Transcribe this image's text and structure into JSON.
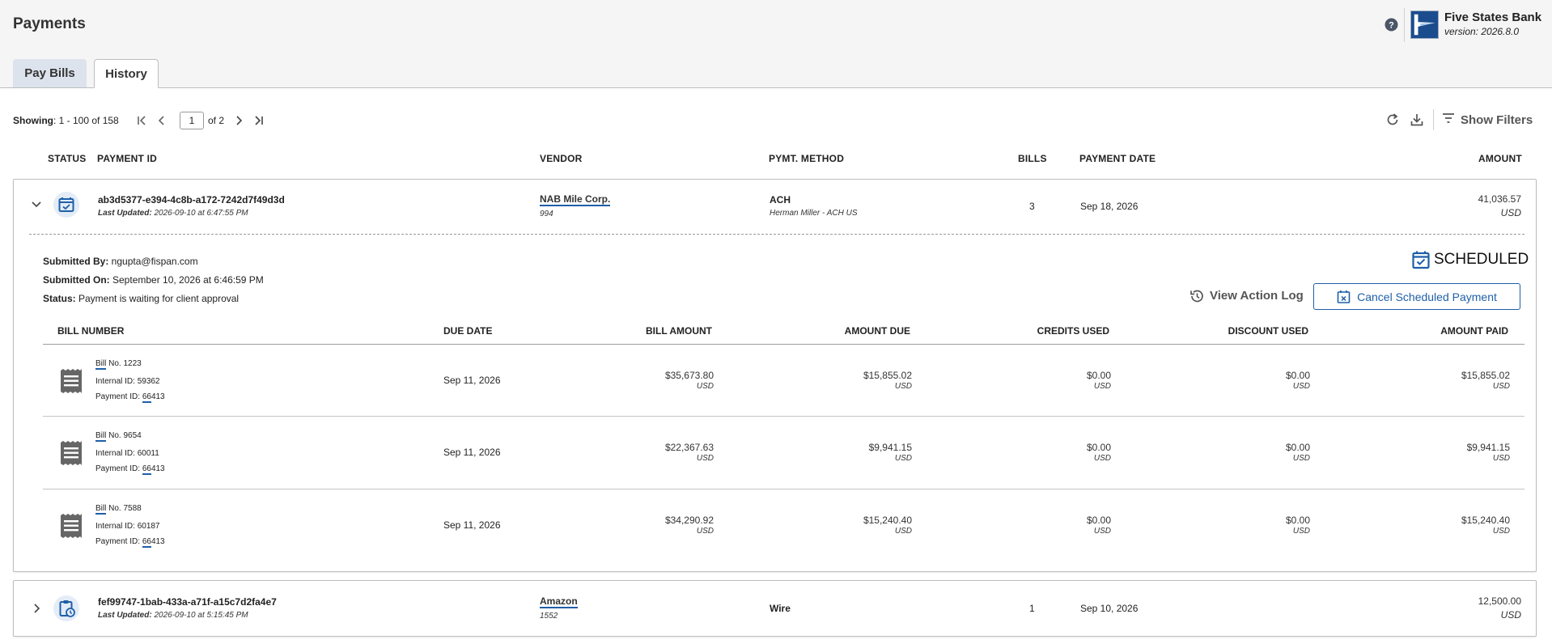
{
  "header": {
    "title": "Payments",
    "bank_name": "Five States Bank",
    "version": "version: 2026.8.0"
  },
  "tabs": [
    {
      "label": "Pay Bills",
      "active": false
    },
    {
      "label": "History",
      "active": true
    }
  ],
  "pager": {
    "showing_label": "Showing",
    "showing_range": ": 1 - 100 of 158",
    "current_page": "1",
    "of_pages": "of 2"
  },
  "toolbar": {
    "show_filters": "Show Filters"
  },
  "columns": {
    "status": "STATUS",
    "payment_id": "PAYMENT ID",
    "vendor": "VENDOR",
    "method": "PYMT. METHOD",
    "bills": "BILLS",
    "payment_date": "PAYMENT DATE",
    "amount": "AMOUNT"
  },
  "payments": [
    {
      "id": "ab3d5377-e394-4c8b-a172-7242d7f49d3d",
      "updated_label": "Last Updated:",
      "updated_value": " 2026-09-10 at 6:47:55 PM",
      "vendor": "NAB Mile Corp.",
      "vendor_id": "994",
      "method": "ACH",
      "method_sub": "Herman Miller - ACH US",
      "bills": "3",
      "payment_date": "Sep 18, 2026",
      "amount": "41,036.57",
      "currency": "USD",
      "expanded": true,
      "details": {
        "submitted_by_label": "Submitted By:",
        "submitted_by": " ngupta@fispan.com",
        "submitted_on_label": "Submitted On:",
        "submitted_on": " September 10, 2026 at 6:46:59 PM",
        "status_label": "Status:",
        "status": " Payment is waiting for client approval",
        "badge": "SCHEDULED",
        "view_action_log": "View Action Log",
        "cancel_button": "Cancel Scheduled Payment"
      },
      "bill_columns": {
        "bill_number": "BILL NUMBER",
        "due_date": "DUE DATE",
        "bill_amount": "BILL AMOUNT",
        "amount_due": "AMOUNT DUE",
        "credits_used": "CREDITS USED",
        "discount_used": "DISCOUNT USED",
        "amount_paid": "AMOUNT PAID"
      },
      "bill_rows": [
        {
          "bill_word": "Bill",
          "bill_no": " No. 1223",
          "internal_id": "Internal ID: 59362",
          "payment_id_label": "Payment ID: ",
          "payment_id_ul": "66",
          "payment_id_rest": "413",
          "due_date": "Sep 11, 2026",
          "bill_amount": "$35,673.80",
          "amount_due": "$15,855.02",
          "credits_used": "$0.00",
          "discount_used": "$0.00",
          "amount_paid": "$15,855.02",
          "currency": "USD"
        },
        {
          "bill_word": "Bill",
          "bill_no": " No. 9654",
          "internal_id": "Internal ID: 60011",
          "payment_id_label": "Payment ID: ",
          "payment_id_ul": "66",
          "payment_id_rest": "413",
          "due_date": "Sep 11, 2026",
          "bill_amount": "$22,367.63",
          "amount_due": "$9,941.15",
          "credits_used": "$0.00",
          "discount_used": "$0.00",
          "amount_paid": "$9,941.15",
          "currency": "USD"
        },
        {
          "bill_word": "Bill",
          "bill_no": " No. 7588",
          "internal_id": "Internal ID: 60187",
          "payment_id_label": "Payment ID: ",
          "payment_id_ul": "66",
          "payment_id_rest": "413",
          "due_date": "Sep 11, 2026",
          "bill_amount": "$34,290.92",
          "amount_due": "$15,240.40",
          "credits_used": "$0.00",
          "discount_used": "$0.00",
          "amount_paid": "$15,240.40",
          "currency": "USD"
        }
      ]
    },
    {
      "id": "fef99747-1bab-433a-a71f-a15c7d2fa4e7",
      "updated_label": "Last Updated:",
      "updated_value": " 2026-09-10 at 5:15:45 PM",
      "vendor": "Amazon",
      "vendor_id": "1552",
      "method": "Wire",
      "method_sub": "",
      "bills": "1",
      "payment_date": "Sep 10, 2026",
      "amount": "12,500.00",
      "currency": "USD",
      "expanded": false
    }
  ],
  "colors": {
    "accent": "#1f5fa8",
    "tab_inactive": "#dde3ed",
    "header_bg": "#f5f5f5"
  },
  "icons": {
    "help": "help-circle-icon",
    "refresh": "refresh-icon",
    "download": "download-icon",
    "filter": "filter-icon",
    "scheduled": "calendar-check-icon",
    "pending": "clipboard-clock-icon",
    "bill": "receipt-icon",
    "history": "history-icon",
    "cancel": "calendar-x-icon"
  }
}
